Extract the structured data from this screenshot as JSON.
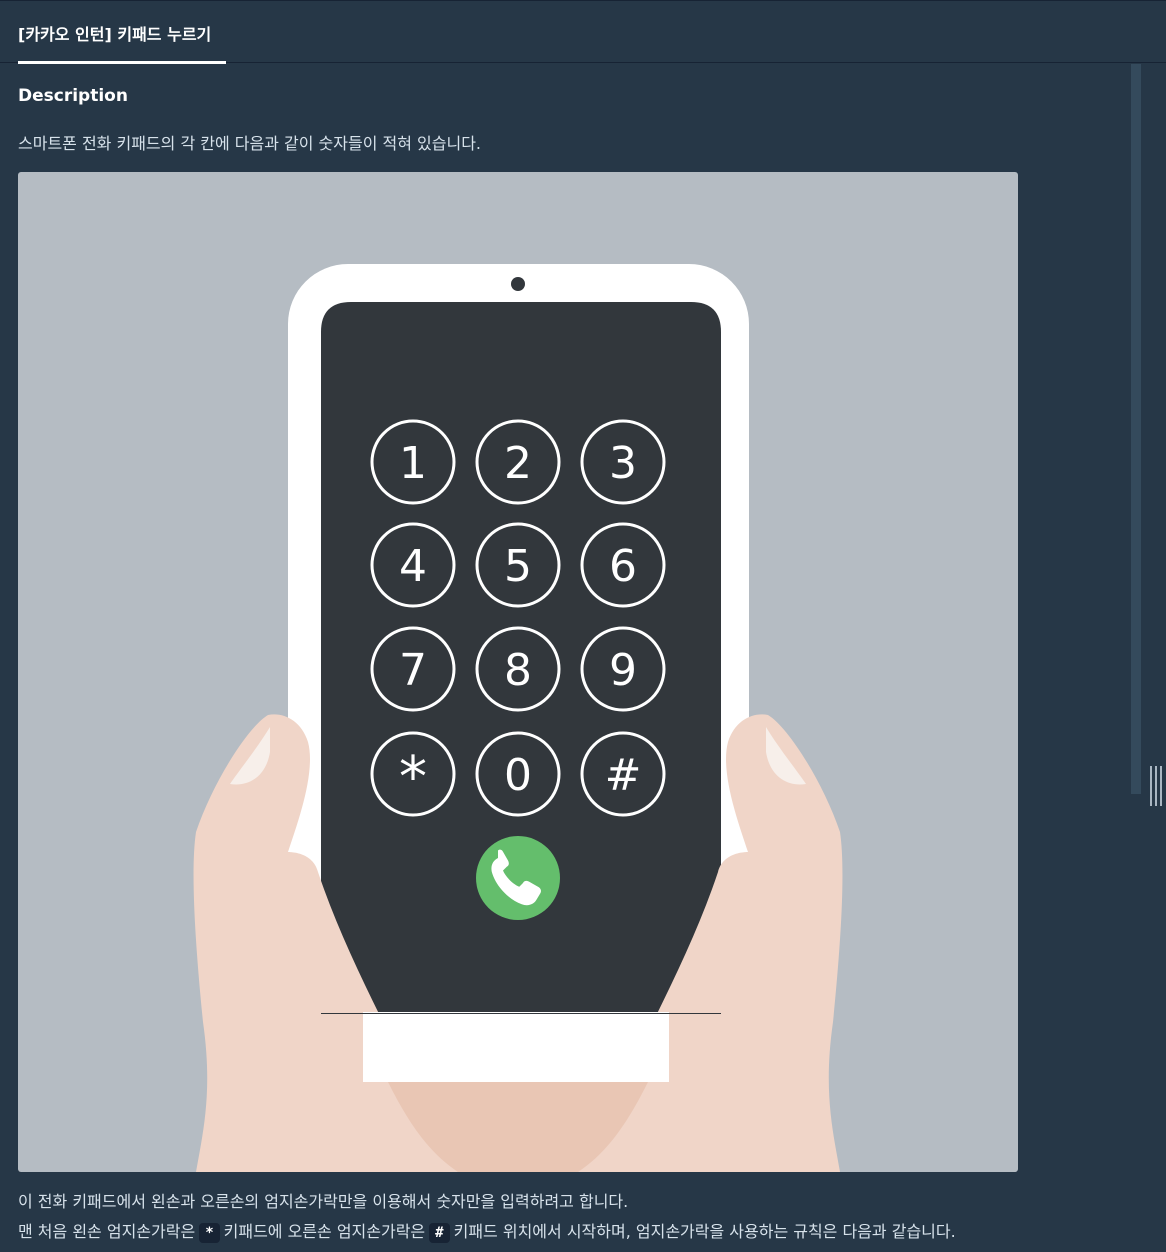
{
  "tab": {
    "title": "[카카오 인턴] 키패드 누르기"
  },
  "description": {
    "heading": "Description",
    "intro": "스마트폰 전화 키패드의 각 칸에 다음과 같이 숫자들이 적혀 있습니다."
  },
  "keypad": {
    "keys": [
      "1",
      "2",
      "3",
      "4",
      "5",
      "6",
      "7",
      "8",
      "9",
      "*",
      "0",
      "#"
    ],
    "call_icon": "phone-call-icon",
    "colors": {
      "background": "#b5bcc3",
      "phone_body": "#ffffff",
      "screen": "#32373c",
      "call_button": "#64be6c",
      "skin": "#f0d5c8"
    }
  },
  "body": {
    "line1": "이 전화 키패드에서 왼손과 오른손의 엄지손가락만을 이용해서 숫자만을 입력하려고 합니다.",
    "line2_part1": "맨 처음 왼손 엄지손가락은",
    "line2_code1": "*",
    "line2_part2": "키패드에 오른손 엄지손가락은",
    "line2_code2": "#",
    "line2_part3": "키패드 위치에서 시작하며, 엄지손가락을 사용하는 규칙은 다음과 같습니다."
  }
}
